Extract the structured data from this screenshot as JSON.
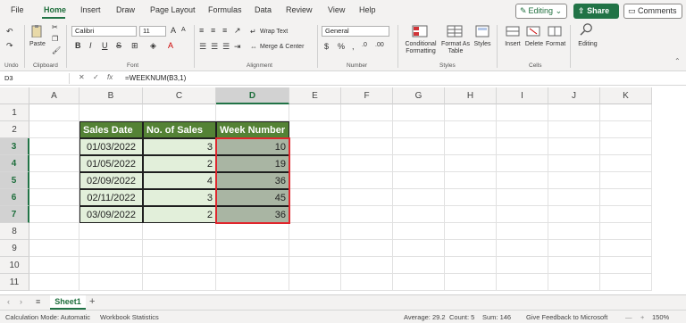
{
  "menu": {
    "items": [
      "File",
      "Home",
      "Insert",
      "Draw",
      "Page Layout",
      "Formulas",
      "Data",
      "Review",
      "View",
      "Help"
    ],
    "active": "Home",
    "editing_label": "Editing",
    "share_label": "Share",
    "comments_label": "Comments"
  },
  "ribbon": {
    "undo_label": "Undo",
    "clipboard": {
      "paste_label": "Paste",
      "group_label": "Clipboard"
    },
    "font": {
      "name": "Calibri",
      "size": "11",
      "group_label": "Font"
    },
    "alignment": {
      "wrap_label": "Wrap Text",
      "merge_label": "Merge & Center",
      "group_label": "Alignment"
    },
    "number": {
      "format": "General",
      "group_label": "Number"
    },
    "styles": {
      "conditional_label": "Conditional Formatting",
      "format_table_label": "Format As Table",
      "styles_label": "Styles",
      "group_label": "Styles"
    },
    "cells": {
      "insert_label": "Insert",
      "delete_label": "Delete",
      "format_label": "Format",
      "group_label": "Cells"
    },
    "editing": {
      "label": "Editing"
    }
  },
  "formula_bar": {
    "name_box": "D3",
    "fx": "fx",
    "formula": "=WEEKNUM(B3,1)"
  },
  "grid": {
    "columns": [
      "A",
      "B",
      "C",
      "D",
      "E",
      "F",
      "G",
      "H",
      "I",
      "J",
      "K"
    ],
    "selected_column": "D",
    "rows": [
      "1",
      "2",
      "3",
      "4",
      "5",
      "6",
      "7",
      "8",
      "9",
      "10",
      "11"
    ],
    "selected_rows": [
      "3",
      "4",
      "5",
      "6",
      "7"
    ],
    "table": {
      "headers": [
        "Sales Date",
        "No. of Sales",
        "Week Number"
      ],
      "rows": [
        [
          "01/03/2022",
          "3",
          "10"
        ],
        [
          "01/05/2022",
          "2",
          "19"
        ],
        [
          "02/09/2022",
          "4",
          "36"
        ],
        [
          "02/11/2022",
          "3",
          "45"
        ],
        [
          "03/09/2022",
          "2",
          "36"
        ]
      ]
    }
  },
  "sheets": {
    "tabs": [
      "Sheet1"
    ],
    "add": "+"
  },
  "status": {
    "calc_mode": "Calculation Mode: Automatic",
    "workbook_stats": "Workbook Statistics",
    "average": "Average: 29.2",
    "count": "Count: 5",
    "sum": "Sum: 146",
    "feedback": "Give Feedback to Microsoft",
    "zoom": "150%"
  },
  "colors": {
    "accent": "#217346",
    "header_fill": "#548235",
    "data_fill": "#e2efda",
    "selection_border": "#e0262d"
  }
}
